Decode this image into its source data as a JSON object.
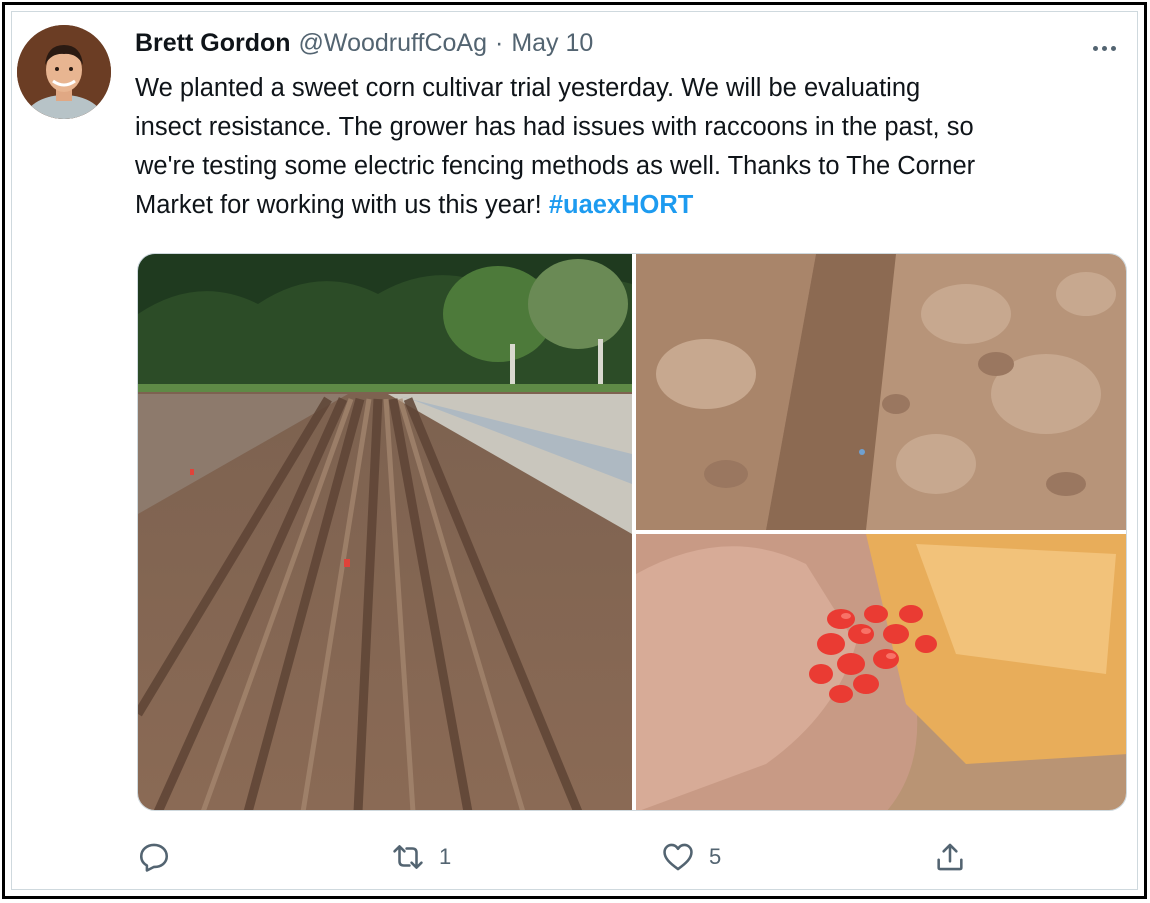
{
  "tweet": {
    "author_name": "Brett Gordon",
    "author_handle": "@WoodruffCoAg",
    "separator": "·",
    "date": "May 10",
    "text_lines": [
      "We planted a sweet corn cultivar trial yesterday.  We will be evaluating",
      "insect resistance. The grower has had issues with raccoons in the past, so",
      "we're testing some electric fencing methods as well. Thanks to The Corner",
      "Market for working with us this year! "
    ],
    "hashtag": "#uaexHORT",
    "avatar_icon": "profile-photo",
    "more_icon": "more-dots-icon"
  },
  "actions": {
    "reply": {
      "icon": "reply-icon",
      "count": ""
    },
    "retweet": {
      "icon": "retweet-icon",
      "count": "1"
    },
    "like": {
      "icon": "heart-icon",
      "count": "5"
    },
    "share": {
      "icon": "share-icon"
    }
  },
  "colors": {
    "text": "#0f1419",
    "secondary": "#536471",
    "link": "#1d9bf0",
    "border": "#cfd9de"
  }
}
